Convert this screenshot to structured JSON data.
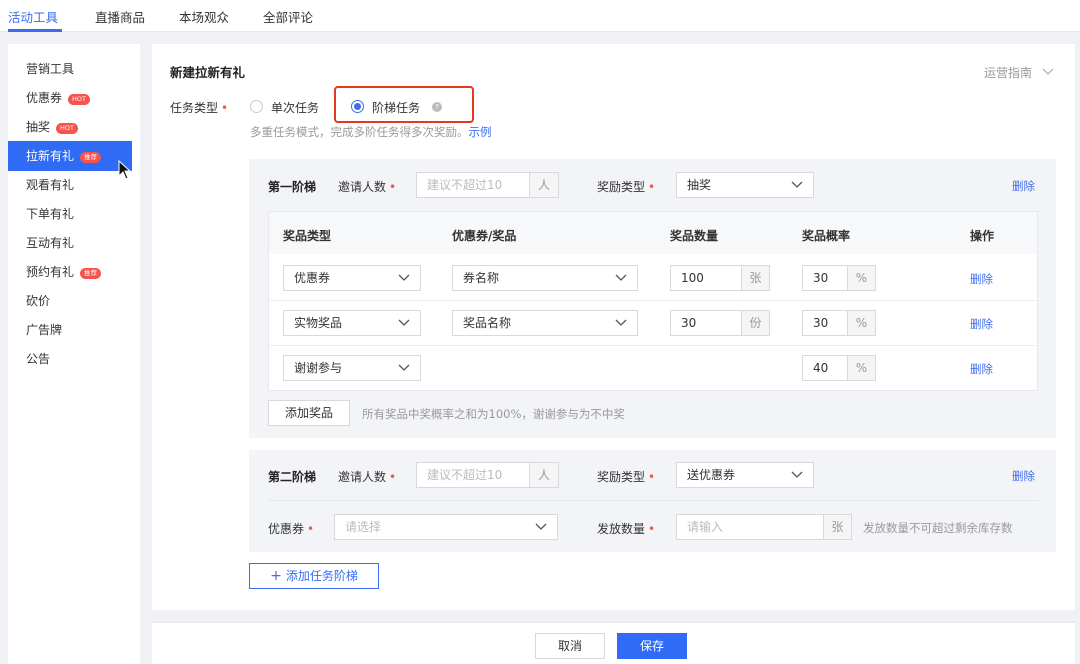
{
  "topTabs": [
    "活动工具",
    "直播商品",
    "本场观众",
    "全部评论"
  ],
  "sidebar": [
    {
      "label": "营销工具",
      "badge": ""
    },
    {
      "label": "优惠券",
      "badge": "HOT"
    },
    {
      "label": "抽奖",
      "badge": "HOT"
    },
    {
      "label": "拉新有礼",
      "badge": "推荐",
      "active": true
    },
    {
      "label": "观看有礼",
      "badge": ""
    },
    {
      "label": "下单有礼",
      "badge": ""
    },
    {
      "label": "互动有礼",
      "badge": ""
    },
    {
      "label": "预约有礼",
      "badge": "推荐"
    },
    {
      "label": "砍价",
      "badge": ""
    },
    {
      "label": "广告牌",
      "badge": ""
    },
    {
      "label": "公告",
      "badge": ""
    }
  ],
  "page": {
    "title": "新建拉新有礼",
    "guide": "运营指南",
    "taskTypeLabel": "任务类型",
    "optionSingle": "单次任务",
    "optionLadder": "阶梯任务",
    "desc": "多重任务模式，完成多阶任务得多次奖励。",
    "exampleLink": "示例"
  },
  "tier1": {
    "title": "第一阶梯",
    "inviteLabel": "邀请人数",
    "invitePlaceholder": "建议不超过10",
    "inviteUnit": "人",
    "rewardTypeLabel": "奖励类型",
    "rewardType": "抽奖",
    "deleteLabel": "删除",
    "headers": [
      "奖品类型",
      "优惠券/奖品",
      "奖品数量",
      "奖品概率",
      "操作"
    ],
    "rows": [
      {
        "type": "优惠券",
        "prize": "券名称",
        "qty": "100",
        "qtyUnit": "张",
        "prob": "30",
        "op": "删除"
      },
      {
        "type": "实物奖品",
        "prize": "奖品名称",
        "qty": "30",
        "qtyUnit": "份",
        "prob": "30",
        "op": "删除"
      },
      {
        "type": "谢谢参与",
        "prize": "",
        "qty": "",
        "qtyUnit": "",
        "prob": "40",
        "op": "删除"
      }
    ],
    "percent": "%",
    "addPrize": "添加奖品",
    "addPrizeHint": "所有奖品中奖概率之和为100%，谢谢参与为不中奖"
  },
  "tier2": {
    "title": "第二阶梯",
    "inviteLabel": "邀请人数",
    "invitePlaceholder": "建议不超过10",
    "inviteUnit": "人",
    "rewardTypeLabel": "奖励类型",
    "rewardType": "送优惠券",
    "deleteLabel": "删除",
    "couponLabel": "优惠券",
    "couponPlaceholder": "请选择",
    "qtyLabel": "发放数量",
    "qtyPlaceholder": "请输入",
    "qtyUnit": "张",
    "qtyHint": "发放数量不可超过剩余库存数"
  },
  "addTier": "添加任务阶梯",
  "footer": {
    "cancel": "取消",
    "save": "保存"
  },
  "colors": {
    "accent": "#2f6bf5",
    "badge": "#f5534b",
    "highlight": "#e4391f"
  }
}
